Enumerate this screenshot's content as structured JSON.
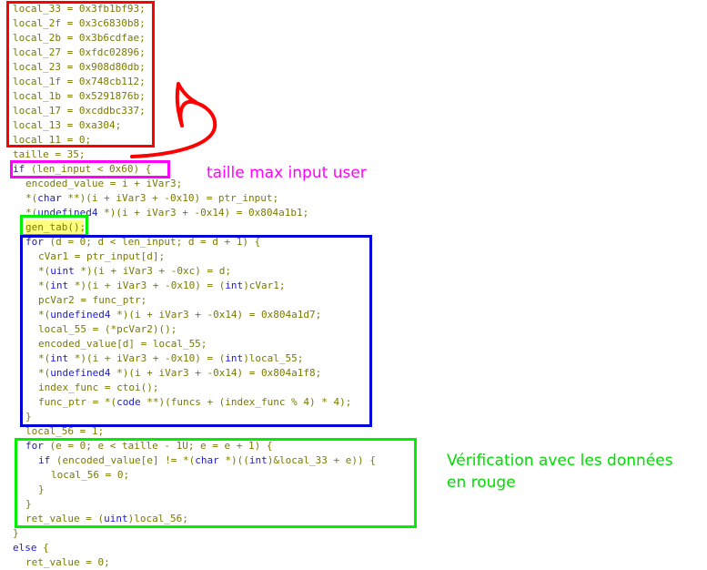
{
  "code_lines": [
    "local_33 = 0x3fb1bf93;",
    "local_2f = 0x3c6830b8;",
    "local_2b = 0x3b6cdfae;",
    "local_27 = 0xfdc02896;",
    "local_23 = 0x908d80db;",
    "local_1f = 0x748cb112;",
    "local_1b = 0x5291876b;",
    "local_17 = 0xcddbc337;",
    "local_13 = 0xa304;",
    "local_11 = 0;",
    "taille = 35;",
    "if (len_input < 0x60) {",
    "encoded_value = i + iVar3;",
    "*(char **)(i + iVar3 + -0x10) = ptr_input;",
    "*(undefined4 *)(i + iVar3 + -0x14) = 0x804a1b1;",
    "gen_tab();",
    "for (d = 0; d < len_input; d = d + 1) {",
    "cVar1 = ptr_input[d];",
    "*(uint *)(i + iVar3 + -0xc) = d;",
    "*(int *)(i + iVar3 + -0x10) = (int)cVar1;",
    "pcVar2 = func_ptr;",
    "*(undefined4 *)(i + iVar3 + -0x14) = 0x804a1d7;",
    "local_55 = (*pcVar2)();",
    "encoded_value[d] = local_55;",
    "*(int *)(i + iVar3 + -0x10) = (int)local_55;",
    "*(undefined4 *)(i + iVar3 + -0x14) = 0x804a1f8;",
    "index_func = ctoi();",
    "func_ptr = *(code **)(funcs + (index_func % 4) * 4);",
    "}",
    "local_56 = 1;",
    "for (e = 0; e < taille - 1U; e = e + 1) {",
    "if (encoded_value[e] != *(char *)((int)&local_33 + e)) {",
    "local_56 = 0;",
    "}",
    "}",
    "ret_value = (uint)local_56;",
    "}",
    "else {",
    "ret_value = 0;"
  ],
  "annotations": {
    "max_input": {
      "text": "taille max input user",
      "color": "#ff00ff"
    },
    "verification": {
      "line1": "Vérification avec les données",
      "line2": "en rouge",
      "color": "#00dd00"
    }
  },
  "colors": {
    "red_box": "#ff0000",
    "magenta_box": "#ff00ff",
    "green_box": "#00ee00",
    "blue_box": "#0000dd",
    "highlight": "#ffff80",
    "arrow": "#ff0000"
  }
}
